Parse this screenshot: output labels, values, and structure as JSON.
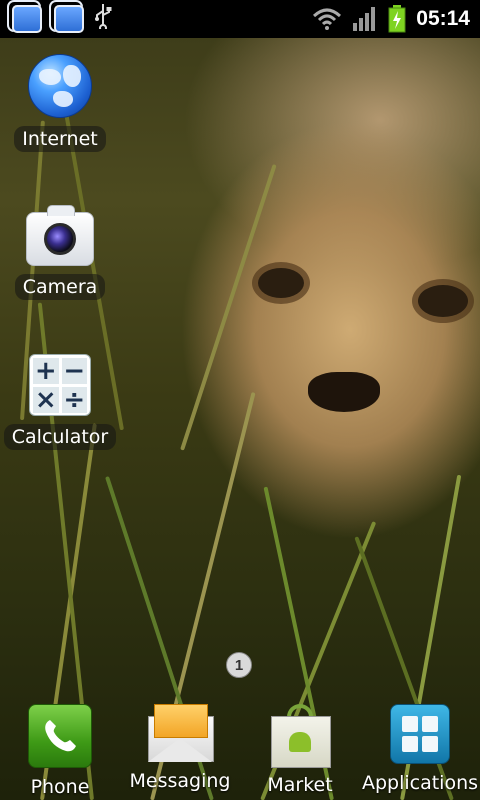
{
  "status_bar": {
    "time": "05:14",
    "icons": [
      "notification-window-icon",
      "notification-window-icon",
      "usb-icon",
      "wifi-icon",
      "signal-icon",
      "battery-charging-icon"
    ]
  },
  "shortcuts": [
    {
      "label": "Internet",
      "icon": "globe-icon"
    },
    {
      "label": "Camera",
      "icon": "camera-icon"
    },
    {
      "label": "Calculator",
      "icon": "calculator-icon"
    }
  ],
  "page_indicator": "1",
  "dock": [
    {
      "label": "Phone",
      "icon": "phone-icon"
    },
    {
      "label": "Messaging",
      "icon": "messaging-icon"
    },
    {
      "label": "Market",
      "icon": "market-icon"
    },
    {
      "label": "Applications",
      "icon": "applications-icon"
    }
  ],
  "calculator_glyphs": [
    "+",
    "−",
    "×",
    "÷"
  ],
  "colors": {
    "status_bar": "#000000",
    "battery": "#7ed321"
  }
}
